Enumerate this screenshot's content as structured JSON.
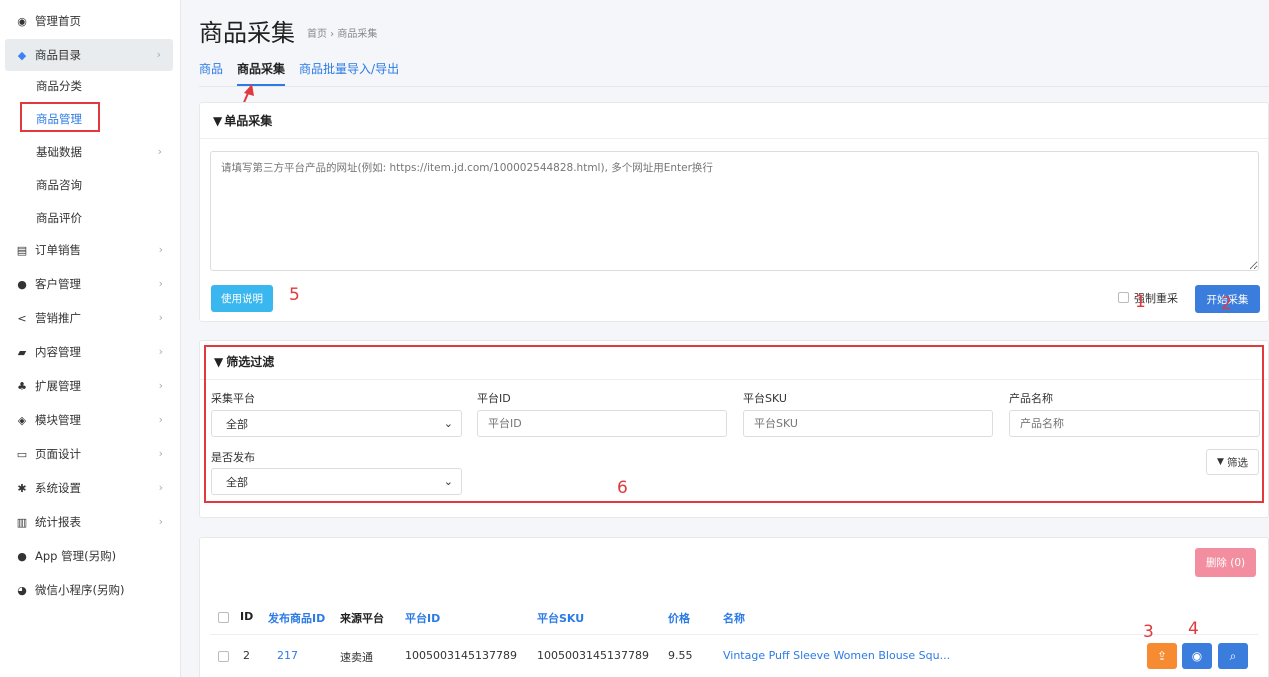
{
  "sidebar": {
    "items": [
      {
        "icon": "dashboard-icon",
        "label": "管理首页"
      },
      {
        "icon": "tag-icon",
        "label": "商品目录"
      },
      {
        "icon": "cart-icon",
        "label": "订单销售"
      },
      {
        "icon": "user-icon",
        "label": "客户管理"
      },
      {
        "icon": "share-icon",
        "label": "营销推广"
      },
      {
        "icon": "book-icon",
        "label": "内容管理"
      },
      {
        "icon": "sitemap-icon",
        "label": "扩展管理"
      },
      {
        "icon": "cube-icon",
        "label": "模块管理"
      },
      {
        "icon": "monitor-icon",
        "label": "页面设计"
      },
      {
        "icon": "gear-icon",
        "label": "系统设置"
      },
      {
        "icon": "bar-chart-icon",
        "label": "统计报表"
      },
      {
        "icon": "apple-icon",
        "label": "App 管理(另购)"
      },
      {
        "icon": "wechat-icon",
        "label": "微信小程序(另购)"
      }
    ],
    "sub_items": [
      "商品分类",
      "商品管理",
      "基础数据",
      "商品咨询",
      "商品评价"
    ]
  },
  "header": {
    "title": "商品采集",
    "breadcrumb": "首页 › 商品采集",
    "tabs": [
      "商品",
      "商品采集",
      "商品批量导入/导出"
    ]
  },
  "single": {
    "title": "单品采集",
    "placeholder": "请填写第三方平台产品的网址(例如: https://item.jd.com/100002544828.html), 多个网址用Enter换行",
    "help_label": "使用说明",
    "force_label": "强制重采",
    "start_label": "开始采集"
  },
  "filter": {
    "title": "筛选过滤",
    "platform_label": "采集平台",
    "platform_value": "全部",
    "platform_id_label": "平台ID",
    "platform_id_placeholder": "平台ID",
    "platform_sku_label": "平台SKU",
    "platform_sku_placeholder": "平台SKU",
    "product_name_label": "产品名称",
    "product_name_placeholder": "产品名称",
    "published_label": "是否发布",
    "published_value": "全部",
    "filter_button": "筛选"
  },
  "table": {
    "delete_label": "删除 (0)",
    "columns": [
      "ID",
      "发布商品ID",
      "来源平台",
      "平台ID",
      "平台SKU",
      "价格",
      "名称"
    ],
    "rows": [
      {
        "id": "2",
        "product_id": "217",
        "platform": "速卖通",
        "platform_id": "1005003145137789",
        "sku": "1005003145137789",
        "price": "9.55",
        "name": "Vintage Puff Sleeve Women Blouse Squ..."
      }
    ]
  },
  "annotations": [
    "1",
    "2",
    "3",
    "4",
    "5",
    "6"
  ],
  "colors": {
    "accent": "#2c7be5",
    "annotation": "#e0393e",
    "cyan_button": "#3bb7ef",
    "delete_button": "#f38ea0",
    "publish_button": "#f68b32"
  }
}
